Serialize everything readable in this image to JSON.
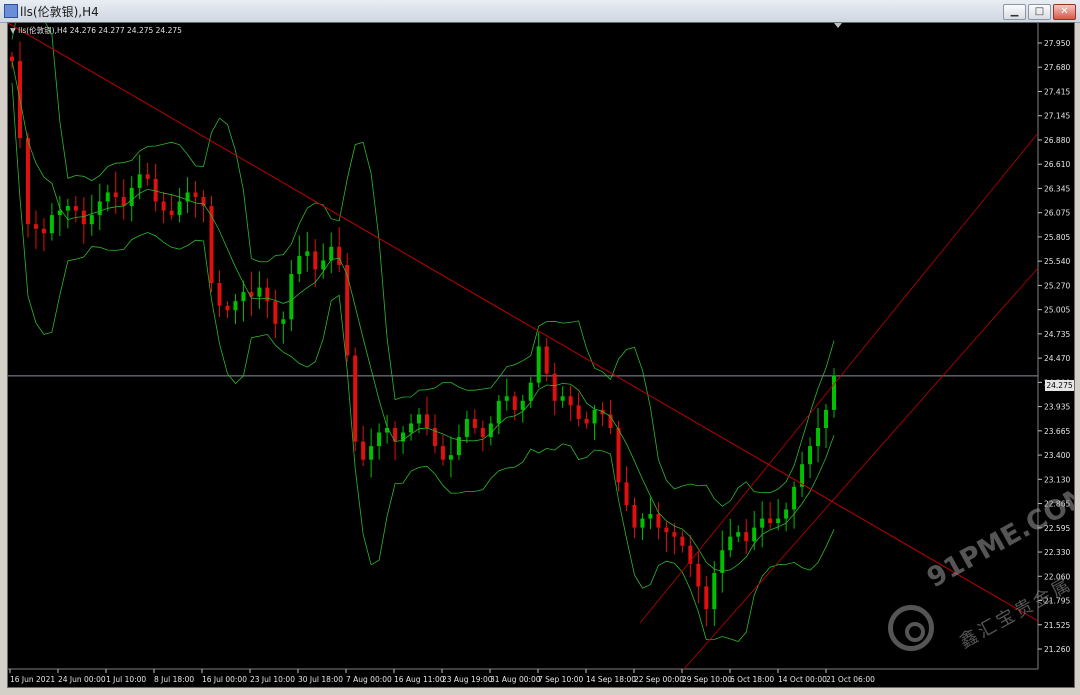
{
  "window": {
    "title": "lls(伦敦银),H4",
    "controls": {
      "minimize": "▁",
      "maximize": "□",
      "close": "✕"
    }
  },
  "chart": {
    "info_arrow": "▼",
    "info_text": "lls(伦敦银),H4  24.276 24.277 24.275 24.275",
    "current_price": "24.275",
    "colors": {
      "background": "#000000",
      "bull": "#00c000",
      "bear": "#e01010",
      "band": "#2db82d",
      "trendline": "#c00000",
      "grid_line": "#8a8fa0"
    }
  },
  "chart_data": {
    "type": "candlestick",
    "symbol": "lls(伦敦银)",
    "timeframe": "H4",
    "ohlc": {
      "open": 24.276,
      "high": 24.277,
      "low": 24.275,
      "close": 24.275
    },
    "price_ticks": [
      "27.950",
      "27.680",
      "27.415",
      "27.145",
      "26.880",
      "26.610",
      "26.345",
      "26.075",
      "25.805",
      "25.540",
      "25.270",
      "25.005",
      "24.735",
      "24.470",
      "24.200",
      "23.935",
      "23.665",
      "23.400",
      "23.130",
      "22.865",
      "22.595",
      "22.330",
      "22.060",
      "21.795",
      "21.525",
      "21.260"
    ],
    "time_ticks": [
      "16 Jun 2021",
      "24 Jun 00:00",
      "1 Jul 10:00",
      "8 Jul 18:00",
      "16 Jul 00:00",
      "23 Jul 10:00",
      "30 Jul 18:00",
      "7 Aug 00:00",
      "16 Aug 11:00",
      "23 Aug 19:00",
      "31 Aug 00:00",
      "7 Sep 10:00",
      "14 Sep 18:00",
      "22 Sep 00:00",
      "29 Sep 10:00",
      "6 Oct 18:00",
      "14 Oct 00:00",
      "21 Oct 06:00"
    ],
    "ylim": [
      21.1,
      28.2
    ],
    "closes": [
      27.75,
      26.9,
      25.95,
      25.9,
      25.85,
      26.05,
      26.1,
      26.15,
      26.1,
      25.95,
      26.05,
      26.2,
      26.3,
      26.25,
      26.15,
      26.35,
      26.5,
      26.45,
      26.2,
      26.1,
      26.05,
      26.2,
      26.3,
      26.25,
      26.15,
      25.3,
      25.05,
      25.0,
      25.1,
      25.2,
      25.15,
      25.25,
      25.1,
      24.85,
      24.9,
      25.4,
      25.6,
      25.65,
      25.45,
      25.55,
      25.7,
      25.5,
      24.5,
      23.55,
      23.35,
      23.5,
      23.65,
      23.7,
      23.55,
      23.65,
      23.75,
      23.85,
      23.7,
      23.5,
      23.35,
      23.4,
      23.6,
      23.8,
      23.7,
      23.6,
      23.75,
      24.0,
      24.05,
      23.9,
      24.0,
      24.2,
      24.6,
      24.3,
      24.0,
      24.05,
      23.95,
      23.8,
      23.75,
      23.9,
      23.85,
      23.7,
      23.1,
      22.85,
      22.6,
      22.7,
      22.75,
      22.6,
      22.55,
      22.5,
      22.4,
      22.2,
      21.95,
      21.7,
      22.1,
      22.35,
      22.5,
      22.55,
      22.45,
      22.6,
      22.7,
      22.65,
      22.7,
      22.8,
      23.05,
      23.3,
      23.5,
      23.7,
      23.9,
      24.28
    ],
    "bollinger": {
      "period_basis": "upper/middle/lower bands"
    },
    "trendlines": 3
  }
}
